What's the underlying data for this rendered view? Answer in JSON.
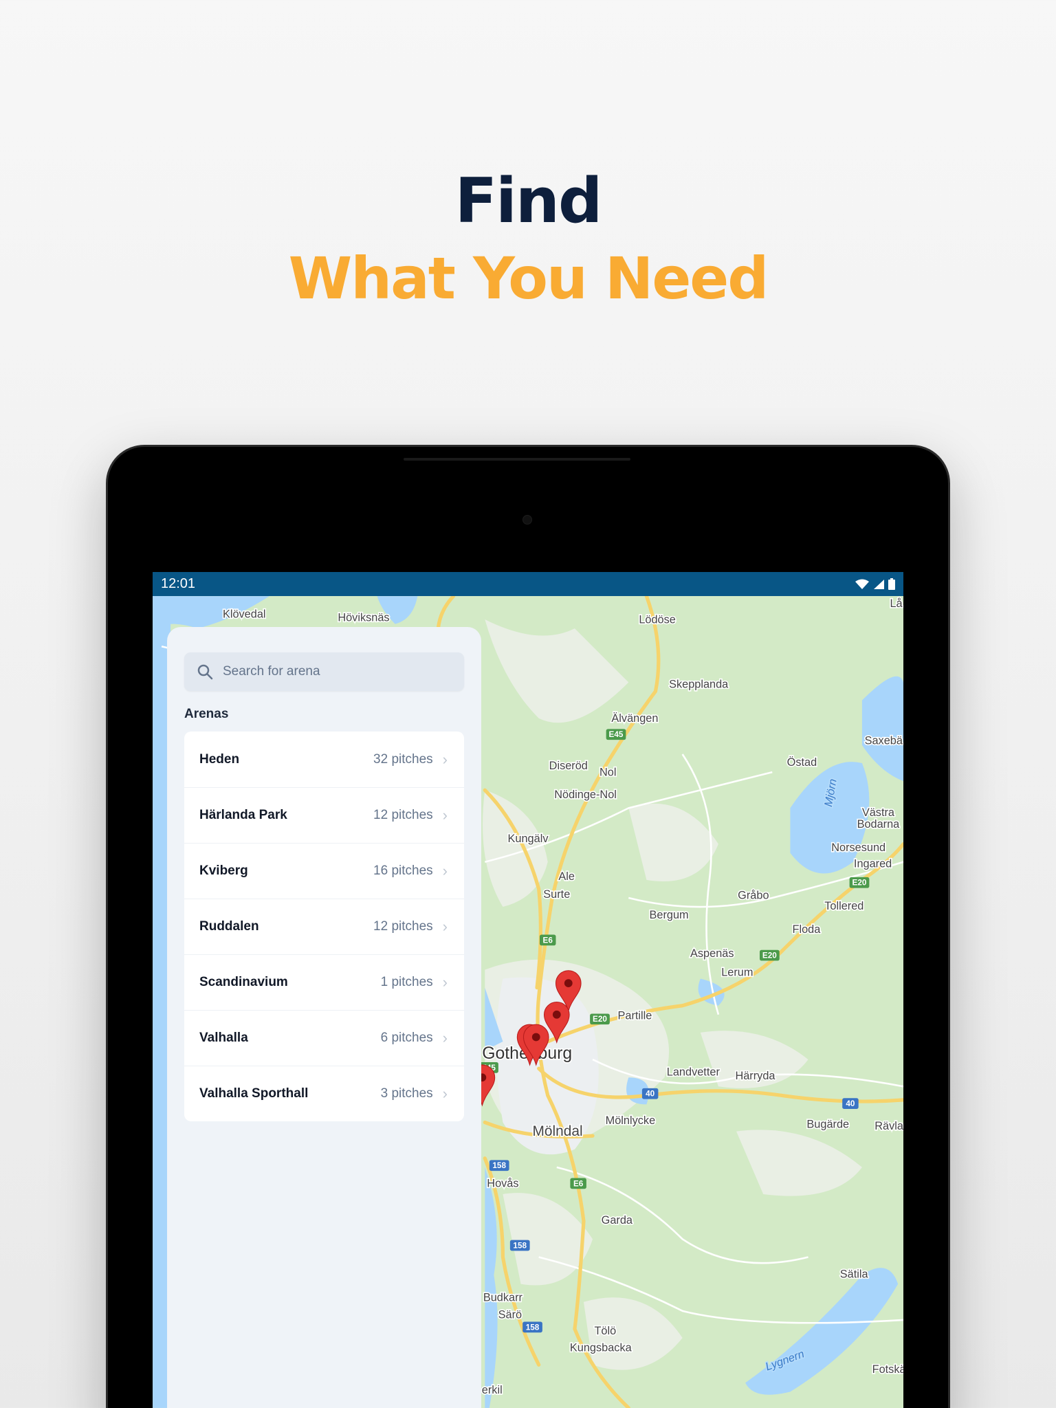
{
  "hero": {
    "line1": "Find",
    "line2": "What You Need",
    "line1_color": "#0e1f3c",
    "line2_color": "#f9ab33"
  },
  "status_bar": {
    "time": "12:01",
    "icons": [
      "wifi-icon",
      "signal-icon",
      "battery-icon"
    ],
    "color": "#085686"
  },
  "search": {
    "placeholder": "Search for arena",
    "icon": "search-icon"
  },
  "arenas": {
    "label": "Arenas",
    "items": [
      {
        "name": "Heden",
        "count": "32 pitches"
      },
      {
        "name": "Härlanda Park",
        "count": "12 pitches"
      },
      {
        "name": "Kviberg",
        "count": "16 pitches"
      },
      {
        "name": "Ruddalen",
        "count": "12 pitches"
      },
      {
        "name": "Scandinavium",
        "count": "1 pitches"
      },
      {
        "name": "Valhalla",
        "count": "6 pitches"
      },
      {
        "name": "Valhalla Sporthall",
        "count": "3 pitches"
      }
    ]
  },
  "map": {
    "places": [
      "Klövedal",
      "Höviksnäs",
      "Lödöse",
      "Lå",
      "Skepplanda",
      "Älvängen",
      "Saxebä",
      "Diseröd",
      "Nol",
      "Östad",
      "Nödinge-Nol",
      "Västra",
      "Bodarna",
      "Kungälv",
      "Norsesund",
      "Ingared",
      "Ale",
      "Surte",
      "Gråbo",
      "Tollered",
      "Bergum",
      "Floda",
      "Aspenäs",
      "Lerum",
      "Partille",
      "Gothenburg",
      "Landvetter",
      "Härryda",
      "Mölnlycke",
      "Bugärde",
      "Rävla",
      "Mölndal",
      "Hovås",
      "Garda",
      "Sätila",
      "Budkarr",
      "Särö",
      "Tölö",
      "Kungsbacka",
      "Fotskä",
      "erkil"
    ],
    "water": [
      "Mjörn",
      "Lygnern"
    ],
    "shields": [
      "E45",
      "E20",
      "E6",
      "E20",
      "E20",
      "40",
      "40",
      "158",
      "E6",
      "158",
      "158",
      "E45"
    ],
    "pin_color": "#e53935",
    "pin_count": 5
  }
}
